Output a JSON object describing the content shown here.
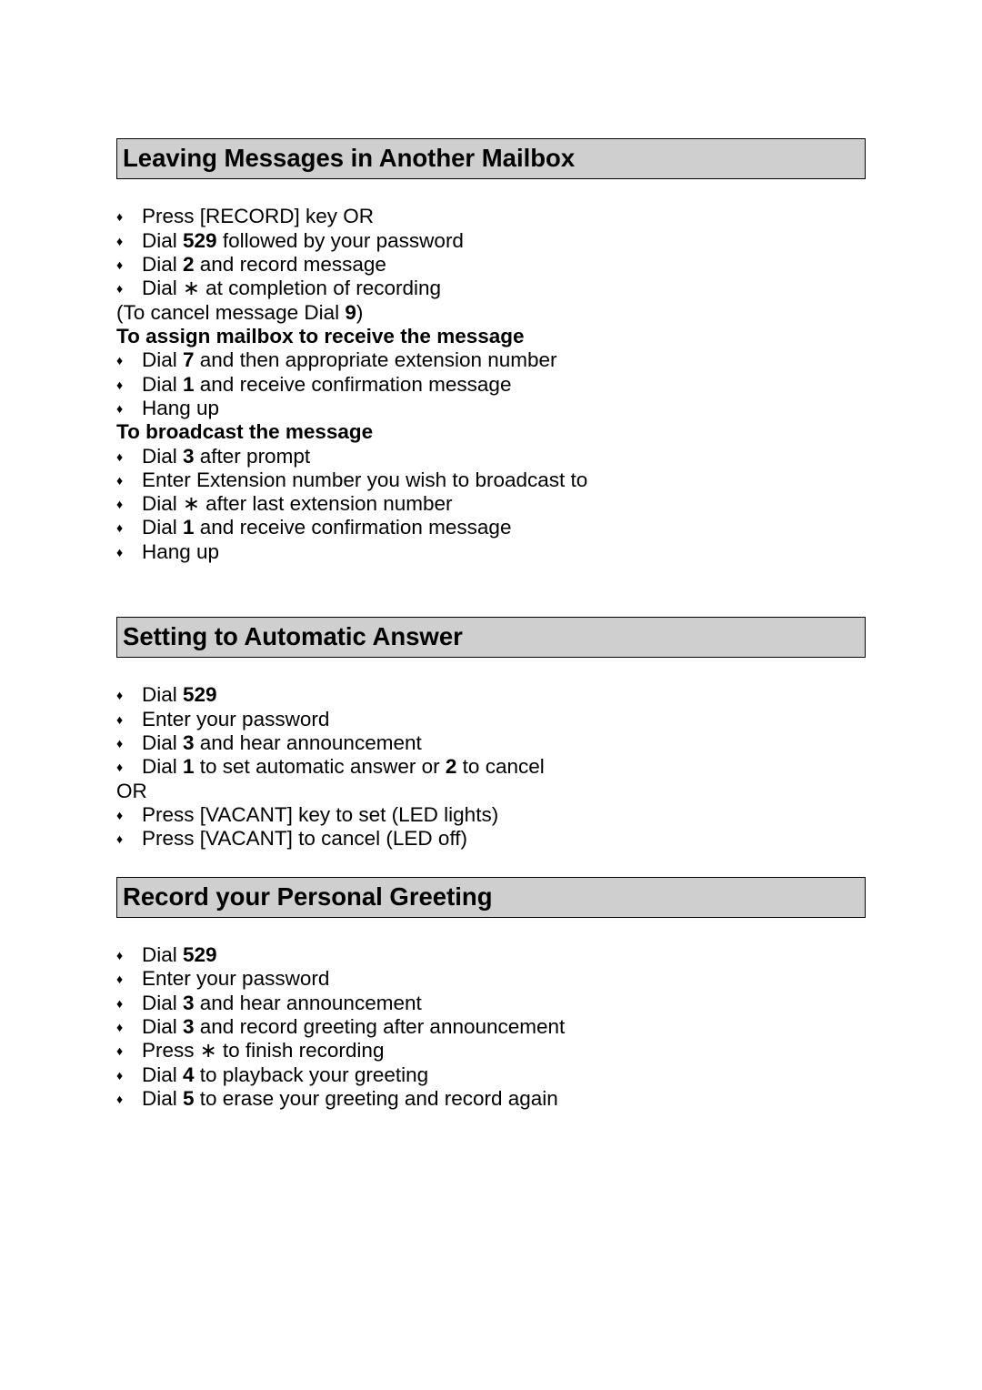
{
  "section1": {
    "heading": "Leaving Messages in Another Mailbox",
    "bullets_a": [
      "Press [RECORD] key OR",
      "Dial <b>529</b> followed by your password",
      "Dial <b>2</b> and record message",
      "Dial ∗ at completion of recording"
    ],
    "cancel_line": "(To cancel message Dial <b>9</b>)",
    "sub1_heading": "To assign mailbox to receive the message",
    "sub1_bullets": [
      "Dial <b>7</b> and then appropriate extension number",
      "Dial <b>1</b> and receive confirmation message",
      "Hang up"
    ],
    "sub2_heading": "To broadcast the message",
    "sub2_bullets": [
      "Dial <b>3</b> after prompt",
      "Enter Extension number you wish to broadcast to",
      "Dial ∗ after last extension number",
      "Dial <b>1</b> and receive confirmation message",
      "Hang up"
    ]
  },
  "section2": {
    "heading": "Setting to Automatic Answer",
    "bullets_a": [
      "Dial <b>529</b>",
      "Enter your password",
      "Dial <b>3</b> and hear announcement",
      "Dial <b>1</b> to set automatic answer or <b>2</b> to cancel"
    ],
    "or_line": "OR",
    "bullets_b": [
      "Press [VACANT] key to set (LED lights)",
      "Press [VACANT] to cancel (LED off)"
    ]
  },
  "section3": {
    "heading": "Record your Personal Greeting",
    "bullets": [
      "Dial <b>529</b>",
      "Enter your password",
      "Dial <b>3</b> and hear announcement",
      "Dial <b>3</b> and record greeting after announcement",
      "Press ∗ to finish recording",
      "Dial <b>4</b> to playback your greeting",
      "Dial <b>5</b> to erase your greeting and record again"
    ]
  }
}
